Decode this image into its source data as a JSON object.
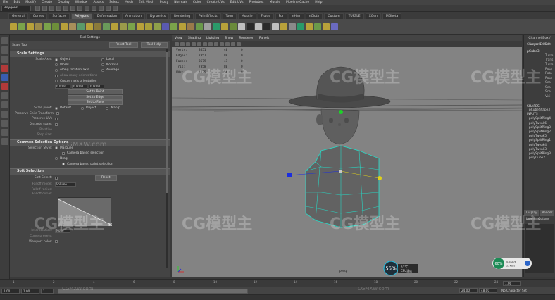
{
  "menubar": [
    "File",
    "Edit",
    "Modify",
    "Create",
    "Display",
    "Window",
    "Assets",
    "Select",
    "Mesh",
    "Edit Mesh",
    "Proxy",
    "Normals",
    "Color",
    "Create UVs",
    "Edit UVs",
    "Photobox",
    "Muscle",
    "Pipeline Cache",
    "Help"
  ],
  "mode_select": "Polygons",
  "shelf_tabs": [
    "General",
    "Curves",
    "Surfaces",
    "Polygons",
    "Deformation",
    "Animation",
    "Dynamics",
    "Rendering",
    "PaintEffects",
    "Toon",
    "Muscle",
    "Fluids",
    "Fur",
    "nHair",
    "nCloth",
    "Custom",
    "TURTLE",
    "XGen",
    "MGbeta"
  ],
  "shelf_active": "Polygons",
  "tool_settings": {
    "panel_title": "Tool Settings",
    "tool_name": "Scale Tool",
    "reset_button": "Reset Tool",
    "help_button": "Tool Help",
    "sections": {
      "scale_settings": "Scale Settings",
      "common_selection": "Common Selection Options",
      "soft_selection": "Soft Selection"
    },
    "scale_axis_label": "Scale Axis:",
    "scale_axis_options": [
      "Object",
      "Local",
      "World",
      "Normal",
      "Along rotation axis",
      "Average"
    ],
    "allow_many": "Allow many orientations",
    "custom_axis": "Custom axis orientation",
    "axis_values": [
      "0.0000",
      "0.0000",
      "0.0000"
    ],
    "set_face": "Set to Point",
    "set_edge": "Set to Edge",
    "set_point": "Set to Face",
    "pivot_label": "Scale pivot:",
    "pivot_options": [
      "Default",
      "Object",
      "Manip"
    ],
    "preserve_child": "Preserve Child Transform",
    "preserve_uvs": "Preserve UVs",
    "discrete_scale": "Discrete scale:",
    "relative": "Relative",
    "step_size": "Step size:",
    "selection_style_label": "Selection Style:",
    "selection_marquee": "Marquee",
    "camera_based": "Camera based selection",
    "drag": "Drag",
    "camera_paint": "Camera based paint selection",
    "soft_select": "Soft Select:",
    "soft_reset": "Reset",
    "falloff_mode": "Falloff mode:",
    "falloff_mode_value": "Volume",
    "falloff_radius": "Falloff radius:",
    "falloff_curve": "Falloff curve:",
    "interpolation": "Interpolation:",
    "interpolation_value": "None",
    "curve_presets": "Curve presets:",
    "viewport_color": "Viewport color:"
  },
  "viewport": {
    "menu": [
      "View",
      "Shading",
      "Lighting",
      "Show",
      "Renderer",
      "Panels"
    ],
    "hud": [
      {
        "label": "Verts:",
        "v1": "3651",
        "v2": "40",
        "v3": "0"
      },
      {
        "label": "Edges:",
        "v1": "7357",
        "v2": "80",
        "v3": "0"
      },
      {
        "label": "Faces:",
        "v1": "3679",
        "v2": "41",
        "v3": "0"
      },
      {
        "label": "Tris:",
        "v1": "7358",
        "v2": "80",
        "v3": "0"
      },
      {
        "label": "UVs:",
        "v1": "4075",
        "v2": "56",
        "v3": "0"
      }
    ],
    "camera_label": "persp"
  },
  "channel_box": {
    "title": "Channel Box / Layer Editor",
    "menu": [
      "Channels",
      "Edit"
    ],
    "node": "pCube3",
    "attrs": [
      "Trans",
      "Trans",
      "Trans",
      "Rota",
      "Rota",
      "Rota",
      "Sca",
      "Sca",
      "Sca",
      "Visi"
    ],
    "shapes_label": "SHAPES",
    "shape_node": "pCubeShape3",
    "inputs_label": "INPUTS",
    "inputs": [
      "polySplitRing4",
      "polyTweak6",
      "polySplitRing3",
      "polySplitRing2",
      "polyTweak5",
      "polySplitRing1",
      "polyTweak4",
      "polyTweak3",
      "polySplitRing3",
      "polyCube2"
    ],
    "tabs": [
      "Display",
      "Render"
    ],
    "subtabs": [
      "Layers",
      "Options"
    ]
  },
  "timeline": {
    "ticks": [
      "1",
      "2",
      "4",
      "6",
      "8",
      "10",
      "12",
      "14",
      "16",
      "18",
      "20",
      "22",
      "24"
    ],
    "current": "1.00"
  },
  "range": {
    "start": "1.00",
    "current": "1.00",
    "frame": "1",
    "end_in": "24.00",
    "end_out": "48.00",
    "no_char": "No Character Set"
  },
  "perf": {
    "cpu_pct": "55%",
    "temp": "53°C",
    "cpu_label": "CPU温度",
    "pct2": "60%",
    "net_up": "0.6Kb/s",
    "net_down": "22Kb/s"
  },
  "watermark": {
    "brand": "CG模型主",
    "url": "CGMXW.com"
  },
  "colors": {
    "viewport_bg": "#838383",
    "selection_cyan": "#29d6c3",
    "accent_green": "#1c8a55",
    "manip_blue": "#1a2de0",
    "manip_yellow": "#e0d21a",
    "manip_green": "#1ed02a"
  }
}
